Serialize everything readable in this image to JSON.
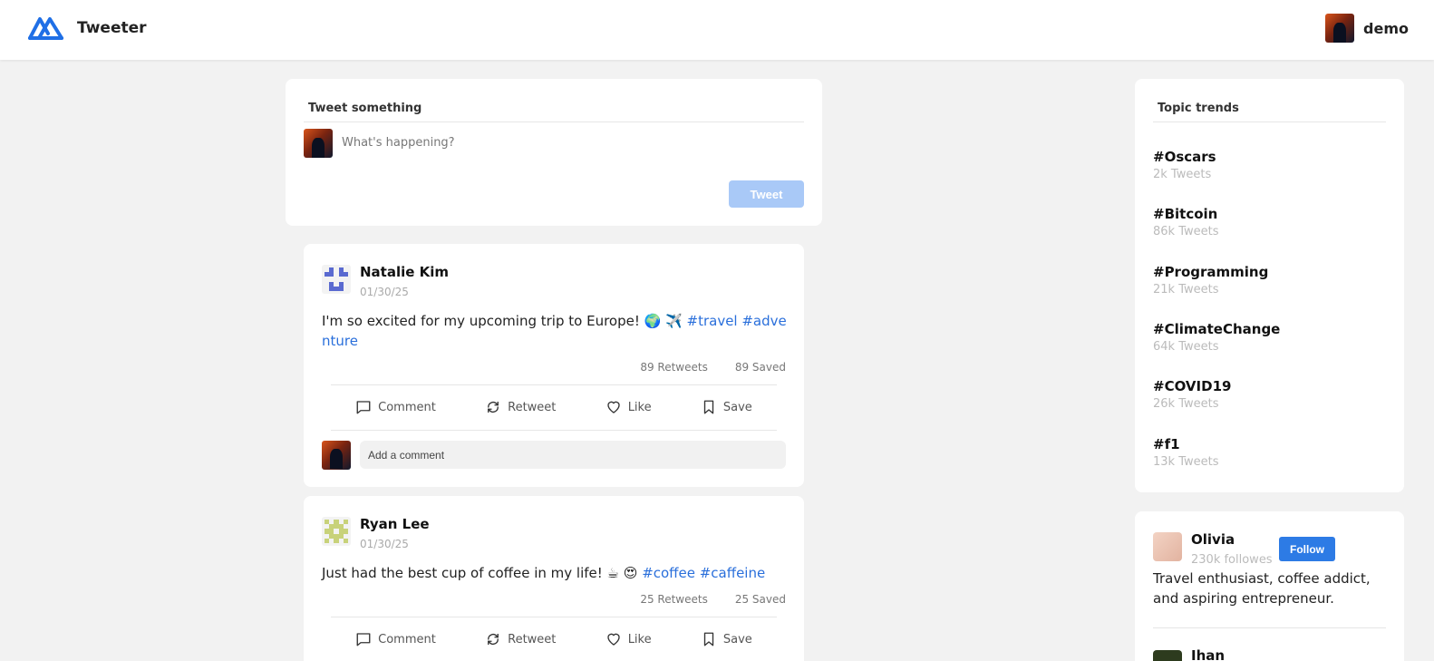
{
  "header": {
    "brand": "Tweeter",
    "user_name": "demo"
  },
  "composer": {
    "title": "Tweet something",
    "placeholder": "What's happening?",
    "button_label": "Tweet"
  },
  "tweets": [
    {
      "author": "Natalie Kim",
      "date": "01/30/25",
      "text": "I'm so excited for my upcoming trip to Europe! 🌍 ✈️ ",
      "hashtags": "#travel #adventure",
      "retweets": "89 Retweets",
      "saved": "89 Saved",
      "identicon_color": "#5a6ad0"
    },
    {
      "author": "Ryan Lee",
      "date": "01/30/25",
      "text": "Just had the best cup of coffee in my life! ☕ 😍 ",
      "hashtags": "#coffee #caffeine",
      "retweets": "25 Retweets",
      "saved": "25 Saved",
      "identicon_color": "#c8d27a"
    }
  ],
  "actions": {
    "comment": "Comment",
    "retweet": "Retweet",
    "like": "Like",
    "save": "Save"
  },
  "comment_placeholder": "Add a comment",
  "trends": {
    "title": "Topic trends",
    "items": [
      {
        "tag": "#Oscars",
        "count": "2k Tweets"
      },
      {
        "tag": "#Bitcoin",
        "count": "86k Tweets"
      },
      {
        "tag": "#Programming",
        "count": "21k Tweets"
      },
      {
        "tag": "#ClimateChange",
        "count": "64k Tweets"
      },
      {
        "tag": "#COVID19",
        "count": "26k Tweets"
      },
      {
        "tag": "#f1",
        "count": "13k Tweets"
      }
    ]
  },
  "follow": {
    "name": "Olivia",
    "followers": "230k followes",
    "button_label": "Follow",
    "bio": "Travel enthusiast, coffee addict, and aspiring entrepreneur.",
    "next_name": "Ihan"
  },
  "colors": {
    "accent": "#2d7be5",
    "hashtag": "#2a6fdb",
    "tweet_button_disabled": "#a9c9f7",
    "background": "#f2f2f2"
  }
}
